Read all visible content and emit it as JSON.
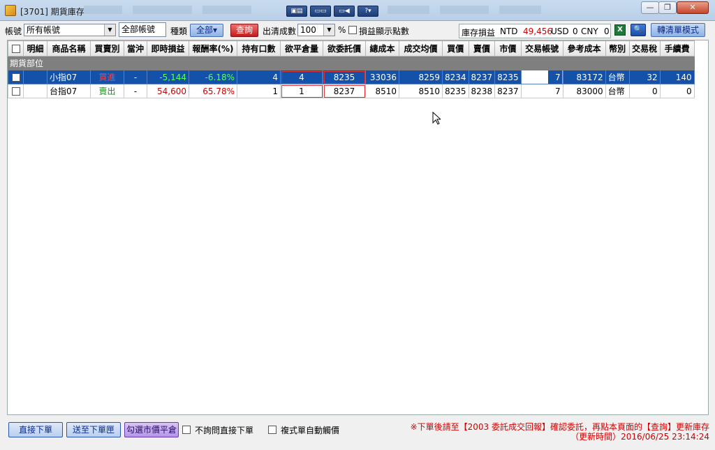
{
  "window": {
    "title": "[3701] 期貨庫存",
    "title_buttons": [
      "▣▤",
      "▭▭",
      "▭◀",
      "?▾"
    ],
    "controls": {
      "minimize": "—",
      "maximize": "❐",
      "close": "✕"
    }
  },
  "toolbar": {
    "account_label": "帳號",
    "account_value": "所有帳號",
    "account_text": "全部帳號",
    "category_label": "種類",
    "category_value": "全部",
    "query_button": "查詢",
    "clear_lots_label": "出清成數",
    "clear_lots_value": "100",
    "percent_label": "%",
    "show_points_label": "損益顯示點數",
    "pnl_label": "庫存損益",
    "ntd_label": "NTD",
    "ntd_value": "49,456",
    "usd_label": "USD",
    "usd_value": "0",
    "cny_label": "CNY",
    "cny_value": "0",
    "excel_icon": "X",
    "zoom_icon": "🔍",
    "switch_mode_button": "轉清單模式"
  },
  "table": {
    "headers": [
      "明細",
      "商品名稱",
      "買賣別",
      "當沖",
      "即時損益",
      "報酬率(%)",
      "持有口數",
      "欲平倉量",
      "欲委託價",
      "總成本",
      "成交均價",
      "買價",
      "賣價",
      "市價",
      "交易帳號",
      "參考成本",
      "幣別",
      "交易稅",
      "手續費"
    ],
    "group_label": "期貨部位",
    "rows": [
      {
        "detail": "",
        "product": "小指07",
        "side": "買進",
        "day_trade": "-",
        "pnl": "-5,144",
        "return": "-6.18%",
        "lots": "4",
        "close_qty": "4",
        "order_price": "8235",
        "total_cost": "33036",
        "avg_price": "8259",
        "bid": "8234",
        "ask": "8237",
        "market": "8235",
        "account": "7",
        "ref_cost": "83172",
        "currency": "台幣",
        "tax": "32",
        "fee": "140"
      },
      {
        "detail": "",
        "product": "台指07",
        "side": "賣出",
        "day_trade": "-",
        "pnl": "54,600",
        "return": "65.78%",
        "lots": "1",
        "close_qty": "1",
        "order_price": "8237",
        "total_cost": "8510",
        "avg_price": "8510",
        "bid": "8235",
        "ask": "8238",
        "market": "8237",
        "account": "7",
        "ref_cost": "83000",
        "currency": "台幣",
        "tax": "0",
        "fee": "0"
      }
    ]
  },
  "bottom": {
    "direct_order": "直接下單",
    "send_to_queue": "送至下單匣",
    "check_market_close": "勾選市價平倉",
    "no_confirm_label": "不詢問直接下單",
    "auto_trigger_label": "複式單自動觸價",
    "note_line1": "※下單後請至【2003 委託成交回報】確認委託，再點本頁面的【查詢】更新庫存",
    "note_line2": "（更新時間）2016/06/25 23:14:24"
  },
  "colors": {
    "selected_row": "#1451a8",
    "group_row": "#7f7f7f",
    "profit": "#d00000",
    "loss": "#00a000"
  }
}
